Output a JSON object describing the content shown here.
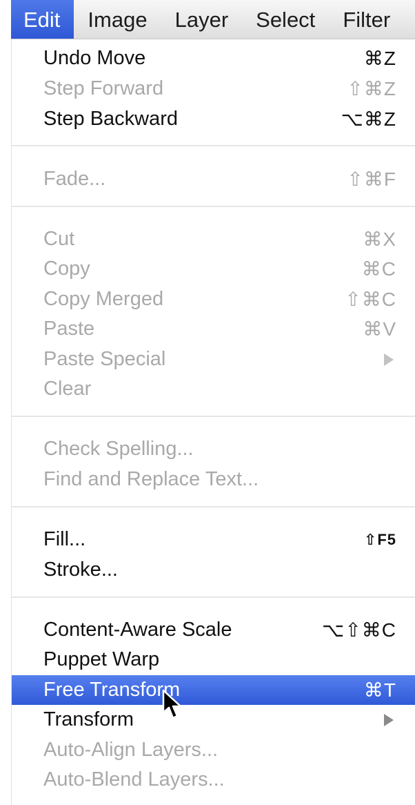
{
  "menubar": {
    "items": [
      {
        "label": "Edit"
      },
      {
        "label": "Image"
      },
      {
        "label": "Layer"
      },
      {
        "label": "Select"
      },
      {
        "label": "Filter"
      }
    ]
  },
  "menu": {
    "undo_move": {
      "label": "Undo Move",
      "shortcut": "⌘Z"
    },
    "step_forward": {
      "label": "Step Forward",
      "shortcut": "⇧⌘Z"
    },
    "step_backward": {
      "label": "Step Backward",
      "shortcut": "⌥⌘Z"
    },
    "fade": {
      "label": "Fade...",
      "shortcut": "⇧⌘F"
    },
    "cut": {
      "label": "Cut",
      "shortcut": "⌘X"
    },
    "copy": {
      "label": "Copy",
      "shortcut": "⌘C"
    },
    "copy_merged": {
      "label": "Copy Merged",
      "shortcut": "⇧⌘C"
    },
    "paste": {
      "label": "Paste",
      "shortcut": "⌘V"
    },
    "paste_special": {
      "label": "Paste Special",
      "submenu_icon": "submenu-arrow-icon"
    },
    "clear": {
      "label": "Clear"
    },
    "check_spelling": {
      "label": "Check Spelling..."
    },
    "find_replace": {
      "label": "Find and Replace Text..."
    },
    "fill": {
      "label": "Fill...",
      "shortcut": "⇧F5"
    },
    "stroke": {
      "label": "Stroke..."
    },
    "content_aware_scale": {
      "label": "Content-Aware Scale",
      "shortcut": "⌥⇧⌘C"
    },
    "puppet_warp": {
      "label": "Puppet Warp"
    },
    "free_transform": {
      "label": "Free Transform",
      "shortcut": "⌘T"
    },
    "transform": {
      "label": "Transform",
      "submenu_icon": "submenu-arrow-icon"
    },
    "auto_align": {
      "label": "Auto-Align Layers..."
    },
    "auto_blend": {
      "label": "Auto-Blend Layers..."
    }
  },
  "colors": {
    "highlight": "#3b63dd",
    "disabled_text": "#a9a9a9",
    "enabled_text": "#111111"
  },
  "cursor_icon": "mouse-pointer-icon"
}
